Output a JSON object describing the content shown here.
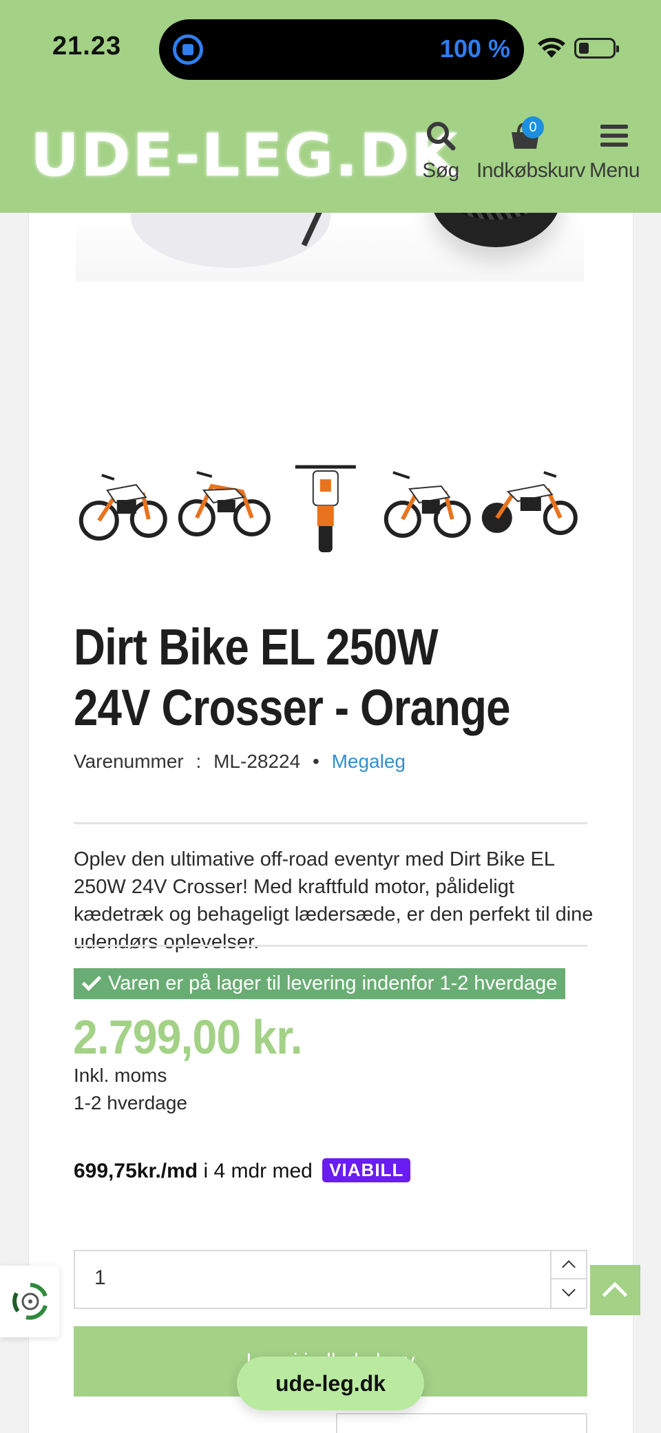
{
  "status_bar": {
    "time": "21.23",
    "battery_percent": "100 %"
  },
  "header": {
    "logo": "UDE-LEG.DK",
    "search_label": "Søg",
    "cart_label": "Indkøbskurv",
    "cart_count": "0",
    "menu_label": "Menu",
    "background_color": "#a3d186"
  },
  "product": {
    "title": "Dirt Bike EL 250W 24V Crosser - Orange",
    "sku_label": "Varenummer",
    "sku_separator": ":",
    "sku": "ML-28224",
    "bullet": "•",
    "brand": "Megaleg",
    "description": "Oplev den ultimative off-road eventyr med Dirt Bike EL 250W 24V Crosser! Med kraftfuld motor, pålideligt kædetræk og behageligt lædersæde, er den perfekt til dine udendørs oplevelser.",
    "stock_text": "Varen er på lager til levering indenfor 1-2 hverdage",
    "price": "2.799,00 kr.",
    "vat_note": "Inkl. moms",
    "delivery_note": "1-2 hverdage",
    "installment_amount": "699,75kr./md",
    "installment_text": "i 4 mdr med",
    "installment_provider": "VIABILL",
    "quantity": "1",
    "add_to_cart_label": "Læg i indkøbskurv",
    "thumbnails": [
      "thumbnail-1",
      "thumbnail-2",
      "thumbnail-3",
      "thumbnail-4",
      "thumbnail-5"
    ]
  },
  "browser": {
    "url": "ude-leg.dk"
  },
  "colors": {
    "accent_green": "#a3d186",
    "stock_green": "#6aad74",
    "link_blue": "#2e8fd4",
    "viabill_purple": "#6a1df0",
    "bike_orange": "#e8731f"
  }
}
